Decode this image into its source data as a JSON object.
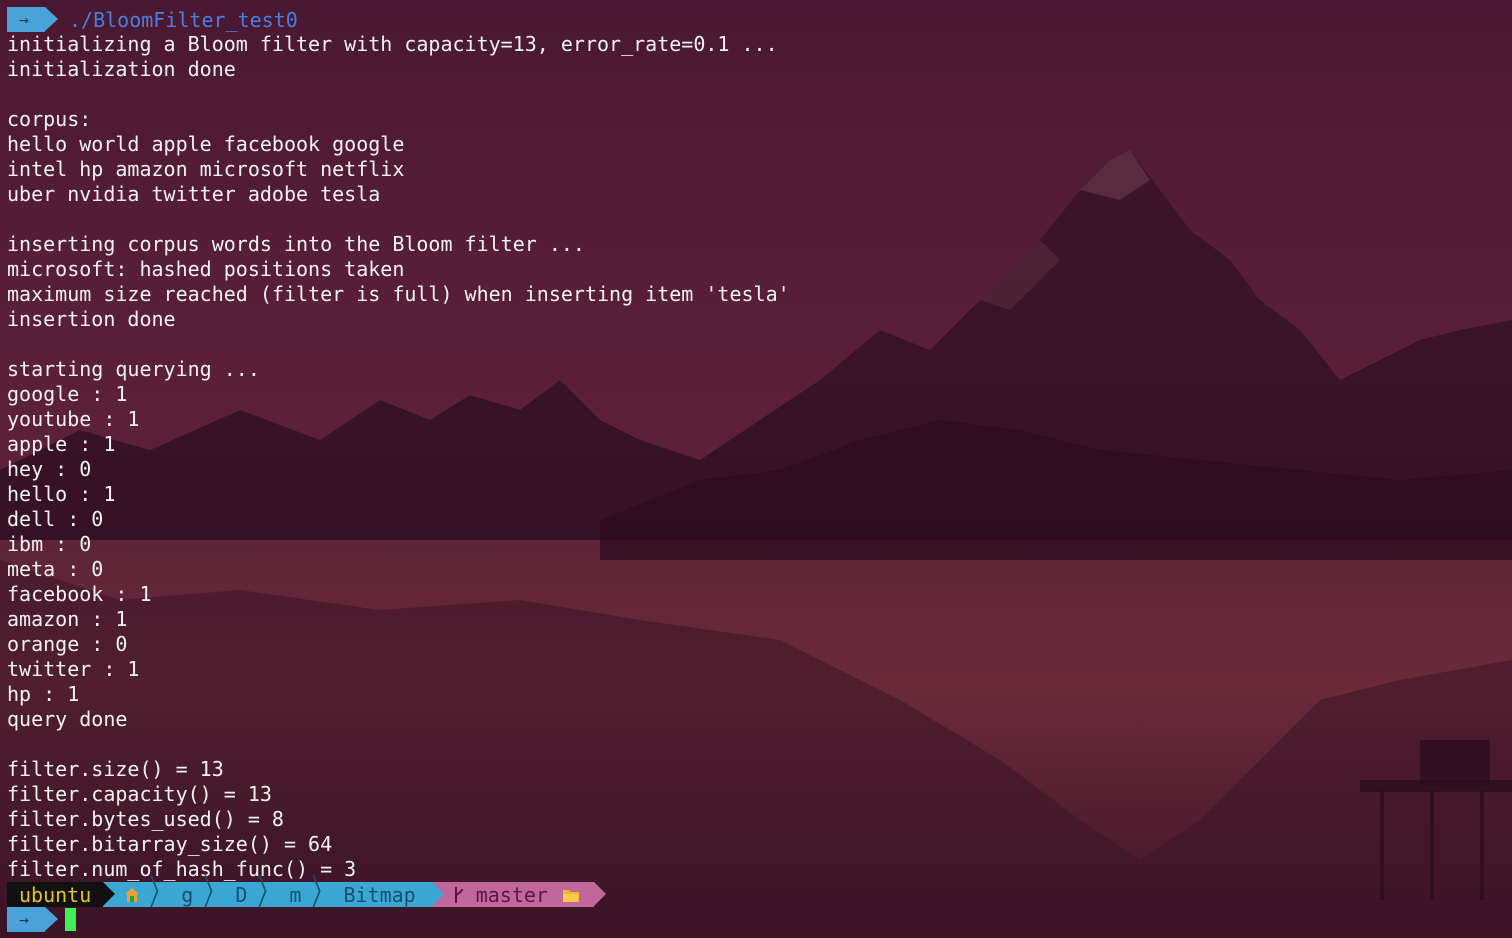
{
  "terminal": {
    "prompt_symbol": "→",
    "command": "./BloomFilter_test0",
    "output_lines": [
      "initializing a Bloom filter with capacity=13, error_rate=0.1 ...",
      "initialization done",
      "",
      "corpus:",
      "hello world apple facebook google",
      "intel hp amazon microsoft netflix",
      "uber nvidia twitter adobe tesla",
      "",
      "inserting corpus words into the Bloom filter ...",
      "microsoft: hashed positions taken",
      "maximum size reached (filter is full) when inserting item 'tesla'",
      "insertion done",
      "",
      "starting querying ...",
      "google : 1",
      "youtube : 1",
      "apple : 1",
      "hey : 0",
      "hello : 1",
      "dell : 0",
      "ibm : 0",
      "meta : 0",
      "facebook : 1",
      "amazon : 1",
      "orange : 0",
      "twitter : 1",
      "hp : 1",
      "query done",
      "",
      "filter.size() = 13",
      "filter.capacity() = 13",
      "filter.bytes_used() = 8",
      "filter.bitarray_size() = 64",
      "filter.num_of_hash_func() = 3"
    ]
  },
  "status_bar": {
    "user": "ubuntu",
    "home_icon": "home-icon",
    "path_items": [
      "g",
      "D",
      "m",
      "Bitmap"
    ],
    "branch_icon": "git-branch-icon",
    "branch": "master",
    "folder_icon": "folder-icon"
  },
  "colors": {
    "prompt_arrow_bg": "#4aa3d8",
    "command_text": "#4a7de0",
    "user_segment_bg": "#111111",
    "user_text": "#e6c229",
    "path_segment_bg": "#3aa7d4",
    "git_segment_bg": "#c2679a",
    "cursor": "#3df05a"
  }
}
